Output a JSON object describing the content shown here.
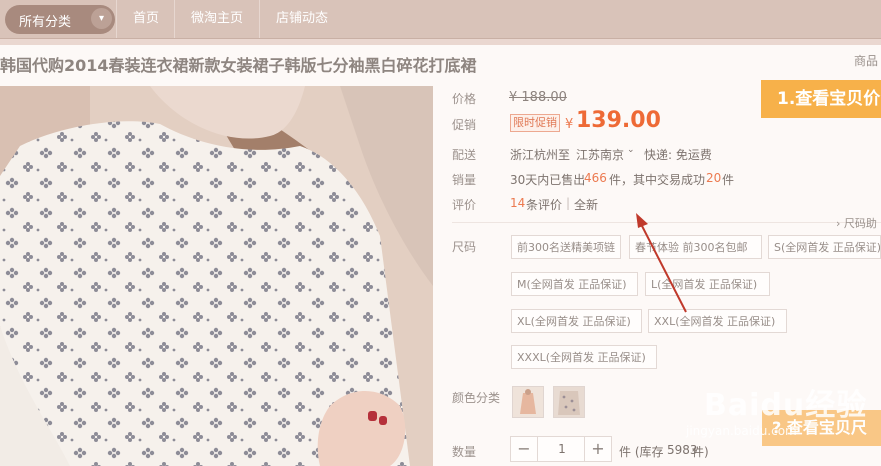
{
  "nav": {
    "all_categories": "所有分类",
    "home": "首页",
    "weitao": "微淘主页",
    "shop_dynamics": "店铺动态"
  },
  "product": {
    "title": "韩国代购2014春装连衣裙新款女装裙子韩版七分袖黑白碎花打底裙",
    "info_link": "商品"
  },
  "price": {
    "label": "价格",
    "original": "¥ 188.00",
    "promo_label": "促销",
    "promo_tag": "限时促销",
    "currency": "¥",
    "current": "139.00"
  },
  "shipping": {
    "label": "配送",
    "from": "浙江杭州",
    "to_word": "至",
    "to": "江苏南京",
    "express": "快递: 免运费"
  },
  "sales": {
    "label": "销量",
    "prefix": "30天内已售出",
    "sold": "466",
    "mid": "件，其中交易成功",
    "success": "20",
    "suffix": "件"
  },
  "reviews": {
    "label": "评价",
    "count": "14",
    "count_suffix": "条评价",
    "sep": "|",
    "quality": "全新"
  },
  "size": {
    "label": "尺码",
    "help": "› 尺码助",
    "options": [
      "前300名送精美项链",
      "春节体验 前300名包邮",
      "S(全网首发 正品保证)",
      "M(全网首发 正品保证)",
      "L(全网首发 正品保证)",
      "XL(全网首发 正品保证)",
      "XXL(全网首发 正品保证)",
      "XXXL(全网首发 正品保证)"
    ]
  },
  "color": {
    "label": "颜色分类"
  },
  "quantity": {
    "label": "数量",
    "value": "1",
    "minus": "−",
    "plus": "+",
    "stock_prefix": "件 (库存",
    "stock": "5983",
    "stock_suffix": "件)"
  },
  "callouts": {
    "first": "1.查看宝贝价",
    "second": "? 查看宝贝尺"
  },
  "watermark": {
    "brand": "Baidu经验",
    "url": "jingyan.baidu.com"
  },
  "colors": {
    "nav_bg": "#d9c3b9",
    "price_orange": "#ee6a36",
    "callout_orange": "#f7b14a",
    "arrow_red": "#c0392b"
  }
}
